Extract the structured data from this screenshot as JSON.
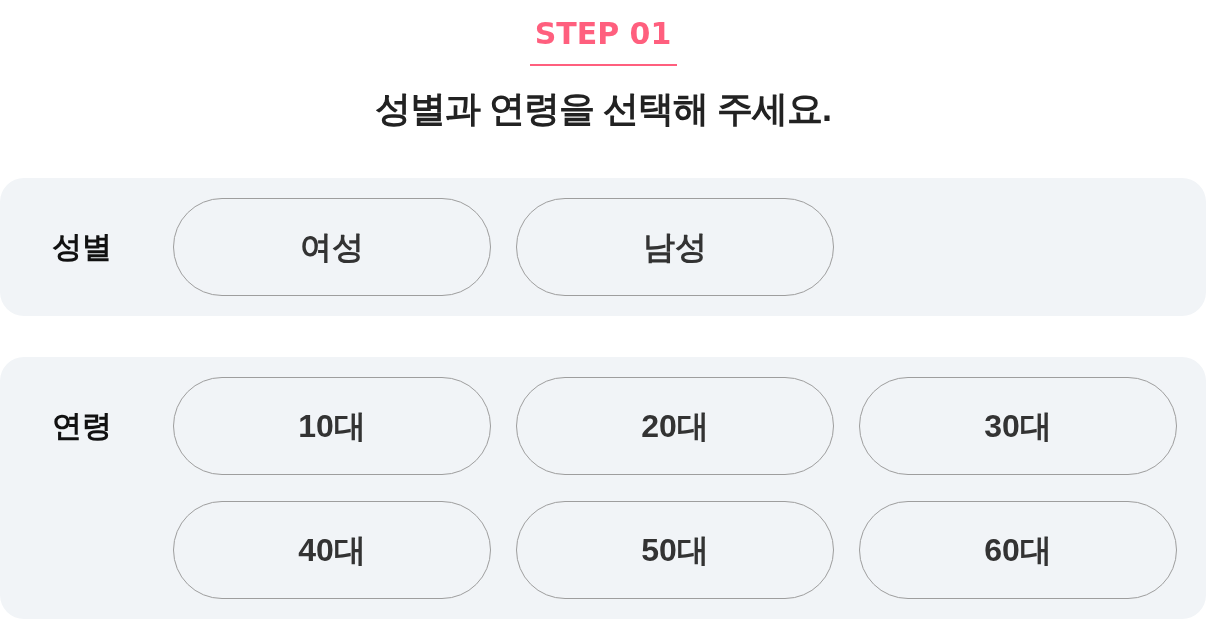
{
  "step": {
    "label": "STEP 01"
  },
  "heading": "성별과 연령을 선택해 주세요.",
  "groups": [
    {
      "label": "성별",
      "options": [
        {
          "label": "여성",
          "selected": false
        },
        {
          "label": "남성",
          "selected": false
        }
      ]
    },
    {
      "label": "연령",
      "options": [
        {
          "label": "10대",
          "selected": false
        },
        {
          "label": "20대",
          "selected": false
        },
        {
          "label": "30대",
          "selected": false
        },
        {
          "label": "40대",
          "selected": false
        },
        {
          "label": "50대",
          "selected": false
        },
        {
          "label": "60대",
          "selected": false
        }
      ]
    }
  ]
}
